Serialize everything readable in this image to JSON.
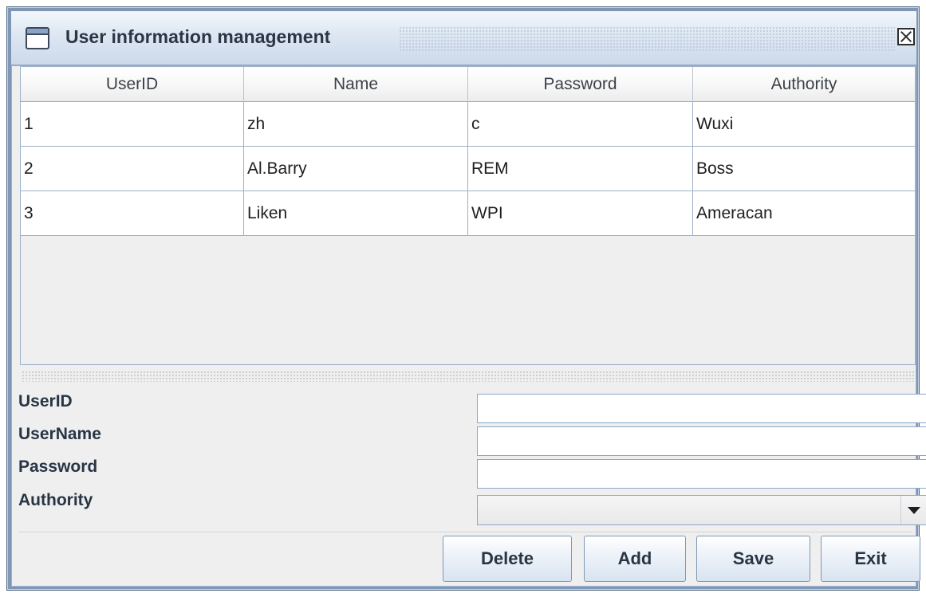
{
  "window": {
    "title": "User information management"
  },
  "table": {
    "columns": [
      "UserID",
      "Name",
      "Password",
      "Authority"
    ],
    "rows": [
      [
        "1",
        "zh",
        "c",
        "Wuxi"
      ],
      [
        "2",
        "Al.Barry",
        "REM",
        "Boss"
      ],
      [
        "3",
        "Liken",
        "WPI",
        "Ameracan"
      ]
    ]
  },
  "form": {
    "userid_label": "UserID",
    "username_label": "UserName",
    "password_label": "Password",
    "authority_label": "Authority",
    "userid_value": "",
    "username_value": "",
    "password_value": "",
    "authority_value": ""
  },
  "buttons": {
    "delete": "Delete",
    "add": "Add",
    "save": "Save",
    "exit": "Exit"
  },
  "icons": {
    "window": "window-icon",
    "close": "close-icon",
    "dropdown": "chevron-down-icon"
  },
  "colors": {
    "titlebar": "#dfe8f3",
    "frame": "#7f97b6",
    "panel": "#efefef"
  }
}
